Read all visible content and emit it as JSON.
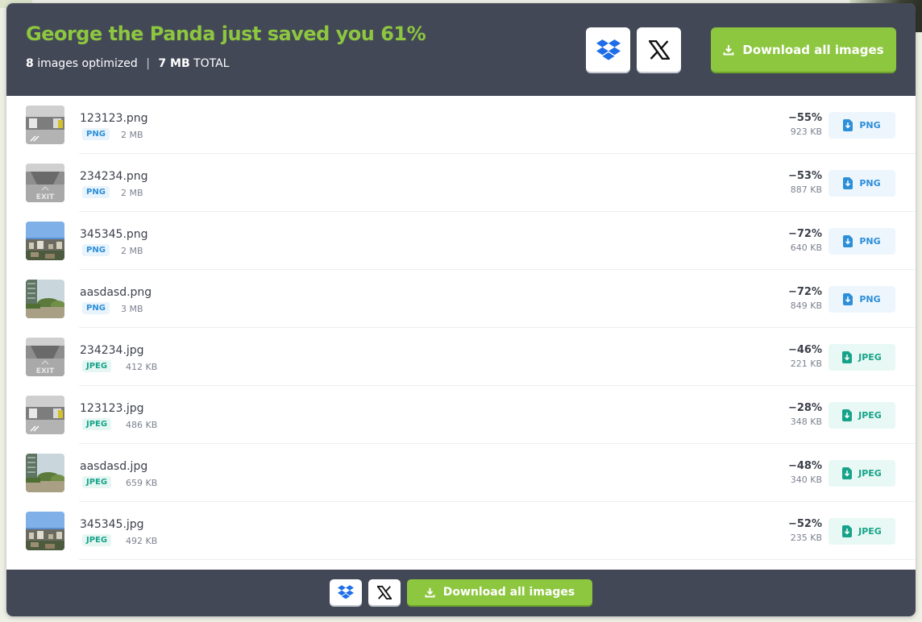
{
  "header": {
    "headline": "George the Panda just saved you 61%",
    "count": "8",
    "count_suffix": "images optimized",
    "separator": "|",
    "total_size": "7 MB",
    "total_label": "TOTAL",
    "download_all_label": "Download all images",
    "dropbox_icon": "dropbox-icon",
    "x_icon": "x-logo-icon"
  },
  "files": [
    {
      "name": "123123.png",
      "type": "PNG",
      "size": "2 MB",
      "pct": "−55%",
      "new_size": "923 KB",
      "thumb": "parking"
    },
    {
      "name": "234234.png",
      "type": "PNG",
      "size": "2 MB",
      "pct": "−53%",
      "new_size": "887 KB",
      "thumb": "exit"
    },
    {
      "name": "345345.png",
      "type": "PNG",
      "size": "2 MB",
      "pct": "−72%",
      "new_size": "640 KB",
      "thumb": "city"
    },
    {
      "name": "aasdasd.png",
      "type": "PNG",
      "size": "3 MB",
      "pct": "−72%",
      "new_size": "849 KB",
      "thumb": "tower"
    },
    {
      "name": "234234.jpg",
      "type": "JPEG",
      "size": "412 KB",
      "pct": "−46%",
      "new_size": "221 KB",
      "thumb": "exit"
    },
    {
      "name": "123123.jpg",
      "type": "JPEG",
      "size": "486 KB",
      "pct": "−28%",
      "new_size": "348 KB",
      "thumb": "parking"
    },
    {
      "name": "aasdasd.jpg",
      "type": "JPEG",
      "size": "659 KB",
      "pct": "−48%",
      "new_size": "340 KB",
      "thumb": "tower"
    },
    {
      "name": "345345.jpg",
      "type": "JPEG",
      "size": "492 KB",
      "pct": "−52%",
      "new_size": "235 KB",
      "thumb": "city"
    }
  ],
  "footer": {
    "download_all_label": "Download all images"
  },
  "colors": {
    "header_bg": "#434857",
    "accent_green": "#8dc63f",
    "png_blue": "#2d8fd8",
    "jpeg_teal": "#17a389"
  }
}
